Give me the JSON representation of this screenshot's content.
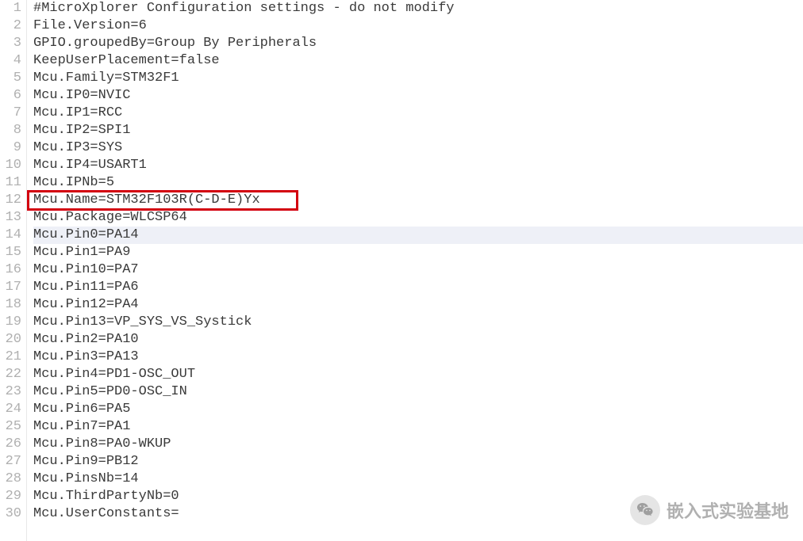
{
  "lines": [
    {
      "num": 1,
      "text": "#MicroXplorer Configuration settings - do not modify"
    },
    {
      "num": 2,
      "text": "File.Version=6"
    },
    {
      "num": 3,
      "text": "GPIO.groupedBy=Group By Peripherals"
    },
    {
      "num": 4,
      "text": "KeepUserPlacement=false"
    },
    {
      "num": 5,
      "text": "Mcu.Family=STM32F1"
    },
    {
      "num": 6,
      "text": "Mcu.IP0=NVIC"
    },
    {
      "num": 7,
      "text": "Mcu.IP1=RCC"
    },
    {
      "num": 8,
      "text": "Mcu.IP2=SPI1"
    },
    {
      "num": 9,
      "text": "Mcu.IP3=SYS"
    },
    {
      "num": 10,
      "text": "Mcu.IP4=USART1"
    },
    {
      "num": 11,
      "text": "Mcu.IPNb=5"
    },
    {
      "num": 12,
      "text": "Mcu.Name=STM32F103R(C-D-E)Yx"
    },
    {
      "num": 13,
      "text": "Mcu.Package=WLCSP64"
    },
    {
      "num": 14,
      "text": "Mcu.Pin0=PA14",
      "highlight": true
    },
    {
      "num": 15,
      "text": "Mcu.Pin1=PA9"
    },
    {
      "num": 16,
      "text": "Mcu.Pin10=PA7"
    },
    {
      "num": 17,
      "text": "Mcu.Pin11=PA6"
    },
    {
      "num": 18,
      "text": "Mcu.Pin12=PA4"
    },
    {
      "num": 19,
      "text": "Mcu.Pin13=VP_SYS_VS_Systick"
    },
    {
      "num": 20,
      "text": "Mcu.Pin2=PA10"
    },
    {
      "num": 21,
      "text": "Mcu.Pin3=PA13"
    },
    {
      "num": 22,
      "text": "Mcu.Pin4=PD1-OSC_OUT"
    },
    {
      "num": 23,
      "text": "Mcu.Pin5=PD0-OSC_IN"
    },
    {
      "num": 24,
      "text": "Mcu.Pin6=PA5"
    },
    {
      "num": 25,
      "text": "Mcu.Pin7=PA1"
    },
    {
      "num": 26,
      "text": "Mcu.Pin8=PA0-WKUP"
    },
    {
      "num": 27,
      "text": "Mcu.Pin9=PB12"
    },
    {
      "num": 28,
      "text": "Mcu.PinsNb=14"
    },
    {
      "num": 29,
      "text": "Mcu.ThirdPartyNb=0"
    },
    {
      "num": 30,
      "text": "Mcu.UserConstants="
    }
  ],
  "watermark": {
    "text": "嵌入式实验基地"
  }
}
